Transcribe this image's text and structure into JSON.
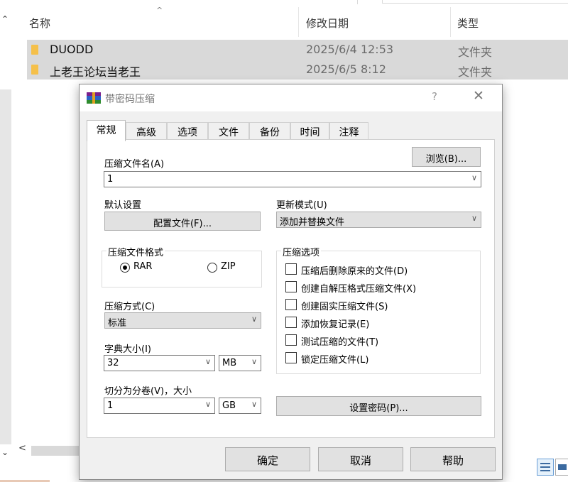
{
  "explorer": {
    "columns": {
      "name": "名称",
      "date": "修改日期",
      "type": "类型"
    },
    "rows": [
      {
        "name": "DUODD",
        "date": "2025/6/4 12:53",
        "type": "文件夹"
      },
      {
        "name": "上老王论坛当老王",
        "date": "2025/6/5 8:12",
        "type": "文件夹"
      }
    ]
  },
  "dialog": {
    "title": "带密码压缩",
    "help_glyph": "?",
    "close_glyph": "✕",
    "tabs": [
      "常规",
      "高级",
      "选项",
      "文件",
      "备份",
      "时间",
      "注释"
    ],
    "archive_name": {
      "label": "压缩文件名(A)",
      "value": "1",
      "browse": "浏览(B)..."
    },
    "default_settings": {
      "label": "默认设置",
      "button": "配置文件(F)..."
    },
    "update_mode": {
      "label": "更新模式(U)",
      "value": "添加并替换文件"
    },
    "format": {
      "label": "压缩文件格式",
      "rar": "RAR",
      "zip": "ZIP",
      "selected": "RAR"
    },
    "method": {
      "label": "压缩方式(C)",
      "value": "标准"
    },
    "dict": {
      "label": "字典大小(I)",
      "value": "32",
      "unit": "MB"
    },
    "split": {
      "label": "切分为分卷(V)，大小",
      "value": "1",
      "unit": "GB"
    },
    "options": {
      "label": "压缩选项",
      "items": [
        "压缩后删除原来的文件(D)",
        "创建自解压格式压缩文件(X)",
        "创建固实压缩文件(S)",
        "添加恢复记录(E)",
        "测试压缩的文件(T)",
        "锁定压缩文件(L)"
      ]
    },
    "set_password": "设置密码(P)...",
    "buttons": {
      "ok": "确定",
      "cancel": "取消",
      "help": "帮助"
    }
  },
  "colors": {
    "folder": "#f5c04a",
    "row_selected": "#d9d9d9",
    "dialog_bg": "#f0f0f0"
  }
}
